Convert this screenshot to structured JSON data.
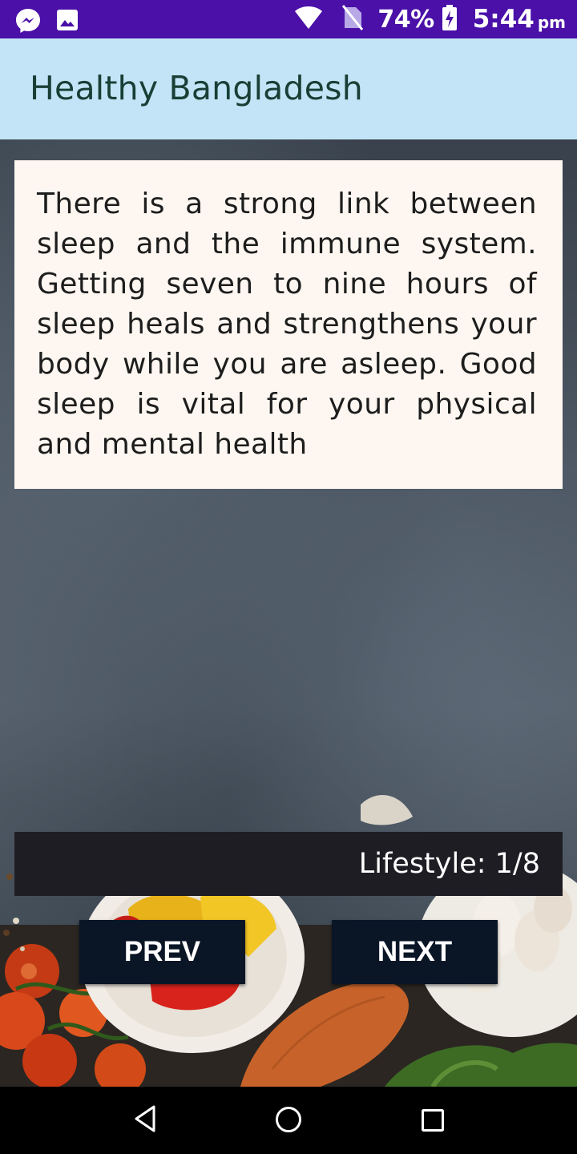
{
  "status_bar": {
    "battery_percent": "74%",
    "time": "5:44",
    "ampm": "pm",
    "icons": [
      "messenger-icon",
      "image-icon",
      "wifi-icon",
      "no-sim-icon",
      "battery-charging-icon"
    ]
  },
  "app_bar": {
    "title": "Healthy Bangladesh"
  },
  "card": {
    "text": "There is a strong link between sleep and the immune system. Getting seven to nine hours of sleep heals and strengthens your body while you are asleep. Good sleep is vital for your physical and mental health"
  },
  "category": {
    "label": "Lifestyle: 1/8"
  },
  "buttons": {
    "prev": "PREV",
    "next": "NEXT"
  },
  "nav_bar": {
    "icons": [
      "back-icon",
      "home-icon",
      "recents-icon"
    ]
  },
  "colors": {
    "status_bar": "#4a10a8",
    "app_bar": "#c2e4f6",
    "title_text": "#173f35",
    "card_bg": "#fef7f1",
    "category_bg": "#1f1d24",
    "button_bg": "#0a1626"
  }
}
